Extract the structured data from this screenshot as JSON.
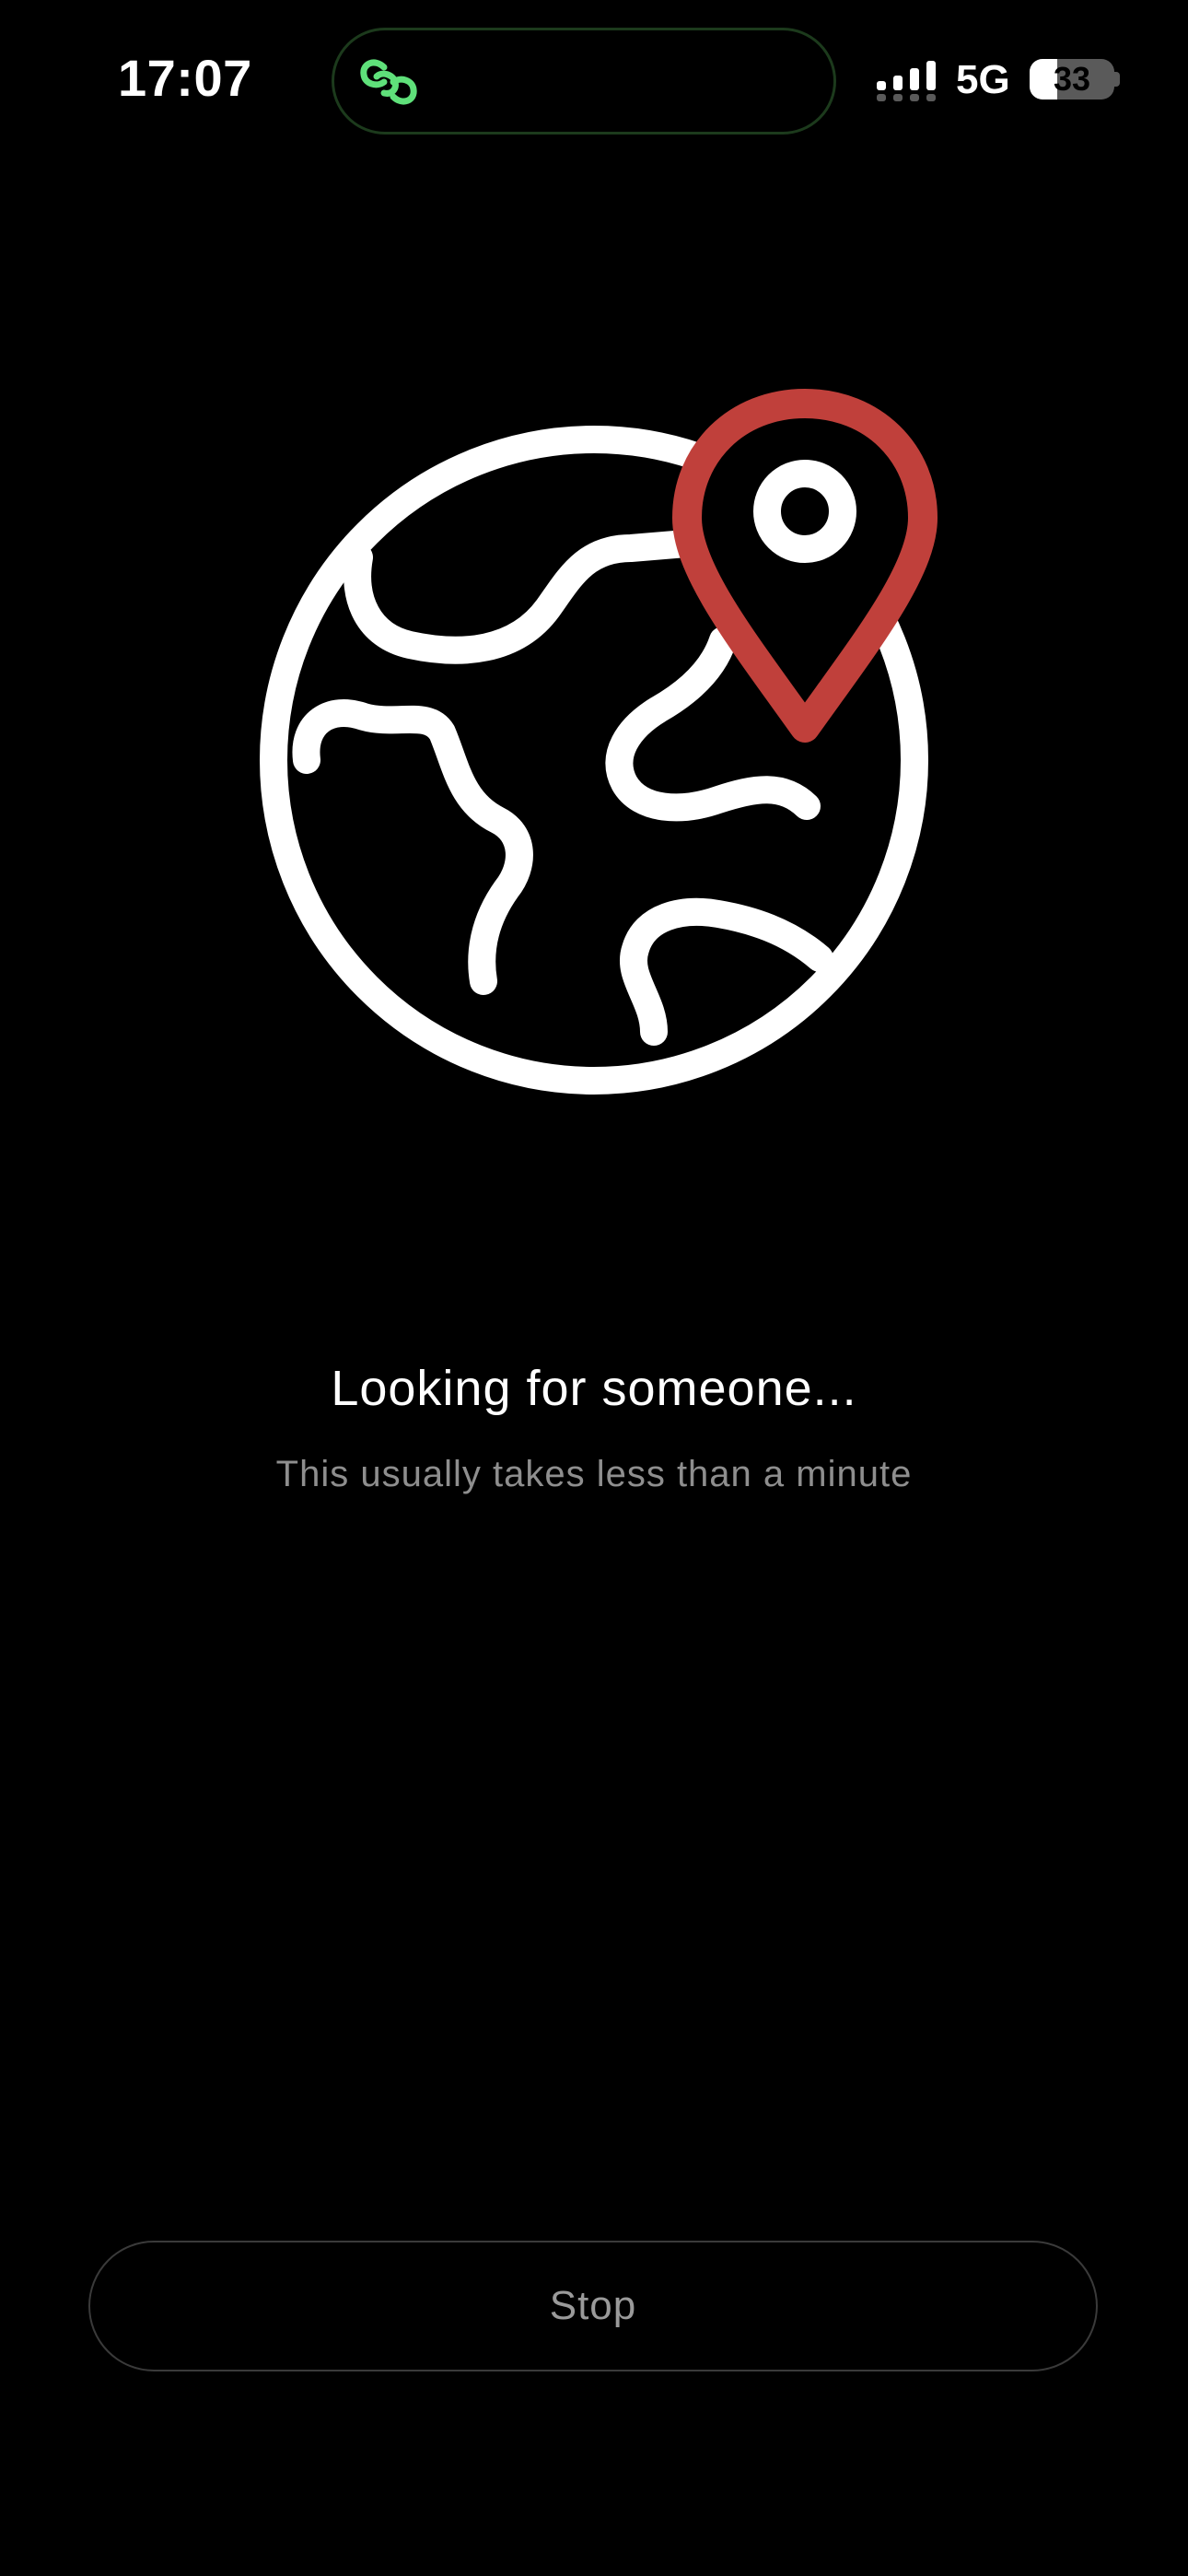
{
  "status_bar": {
    "time": "17:07",
    "network": "5G",
    "battery_percent": "33",
    "battery_level": 0.33,
    "island_icon": "link-icon",
    "island_icon_color": "#5fe07a"
  },
  "illustration": {
    "icon": "globe-location-pin-icon",
    "globe_color": "#ffffff",
    "pin_color": "#c0403b"
  },
  "search": {
    "title": "Looking for someone...",
    "subtitle": "This usually takes less than a minute"
  },
  "actions": {
    "stop_label": "Stop"
  }
}
